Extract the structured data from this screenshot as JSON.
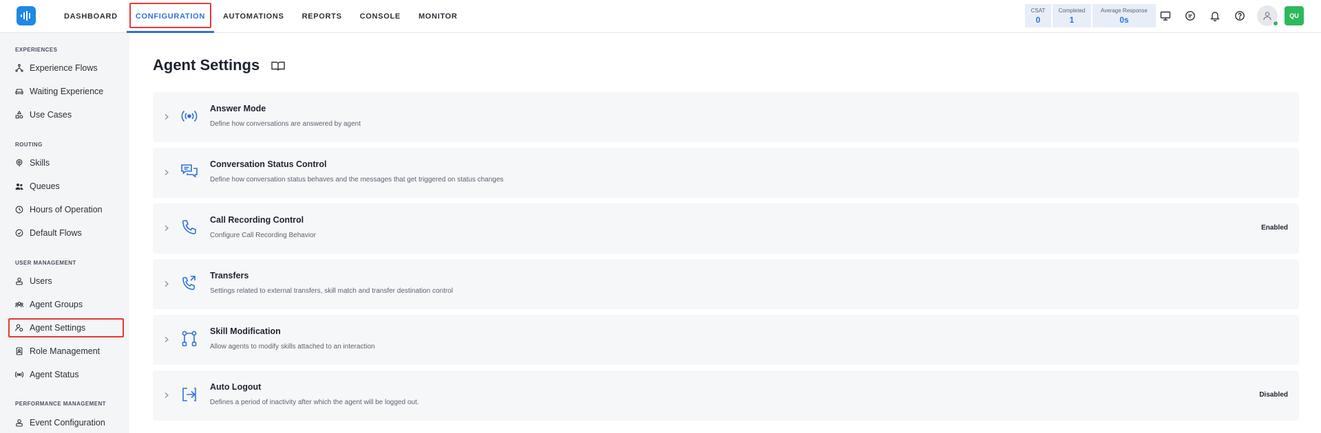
{
  "nav": {
    "items": [
      {
        "label": "DASHBOARD"
      },
      {
        "label": "CONFIGURATION"
      },
      {
        "label": "AUTOMATIONS"
      },
      {
        "label": "REPORTS"
      },
      {
        "label": "CONSOLE"
      },
      {
        "label": "MONITOR"
      }
    ],
    "active": "CONFIGURATION"
  },
  "stats": [
    {
      "label": "CSAT",
      "value": "0"
    },
    {
      "label": "Completed",
      "value": "1"
    },
    {
      "label": "Average Response",
      "value": "0s"
    }
  ],
  "user": {
    "initials": "QU",
    "status": "online"
  },
  "sidebar": {
    "sections": [
      {
        "title": "EXPERIENCES",
        "items": [
          {
            "label": "Experience Flows",
            "icon": "flow-icon"
          },
          {
            "label": "Waiting Experience",
            "icon": "sofa-icon"
          },
          {
            "label": "Use Cases",
            "icon": "shapes-icon"
          }
        ]
      },
      {
        "title": "ROUTING",
        "items": [
          {
            "label": "Skills",
            "icon": "skill-icon"
          },
          {
            "label": "Queues",
            "icon": "people-icon"
          },
          {
            "label": "Hours of Operation",
            "icon": "clock-icon"
          },
          {
            "label": "Default Flows",
            "icon": "default-flow-icon"
          }
        ]
      },
      {
        "title": "USER MANAGEMENT",
        "items": [
          {
            "label": "Users",
            "icon": "user-icon"
          },
          {
            "label": "Agent Groups",
            "icon": "group-icon"
          },
          {
            "label": "Agent Settings",
            "icon": "agent-settings-icon"
          },
          {
            "label": "Role Management",
            "icon": "role-icon"
          },
          {
            "label": "Agent Status",
            "icon": "broadcast-icon"
          }
        ]
      },
      {
        "title": "PERFORMANCE MANAGEMENT",
        "items": [
          {
            "label": "Event Configuration",
            "icon": "event-icon"
          }
        ]
      }
    ],
    "active": "Agent Settings"
  },
  "page": {
    "title": "Agent Settings"
  },
  "settings": [
    {
      "title": "Answer Mode",
      "description": "Define how conversations are answered by agent",
      "status": "",
      "icon": "broadcast-icon"
    },
    {
      "title": "Conversation Status Control",
      "description": "Define how conversation status behaves and the messages that get triggered on status changes",
      "status": "",
      "icon": "chat-bubbles-icon"
    },
    {
      "title": "Call Recording Control",
      "description": "Configure Call Recording Behavior",
      "status": "Enabled",
      "icon": "phone-icon"
    },
    {
      "title": "Transfers",
      "description": "Settings related to external transfers, skill match and transfer destination control",
      "status": "",
      "icon": "phone-transfer-icon"
    },
    {
      "title": "Skill Modification",
      "description": "Allow agents to modify skills attached to an interaction",
      "status": "",
      "icon": "nodes-icon"
    },
    {
      "title": "Auto Logout",
      "description": "Defines a period of inactivity after which the agent will be logged out.",
      "status": "Disabled",
      "icon": "logout-icon"
    }
  ],
  "colors": {
    "accent": "#2f72d9",
    "highlight": "#e53935",
    "brand": "#1e88e5",
    "online": "#2eb85c"
  }
}
